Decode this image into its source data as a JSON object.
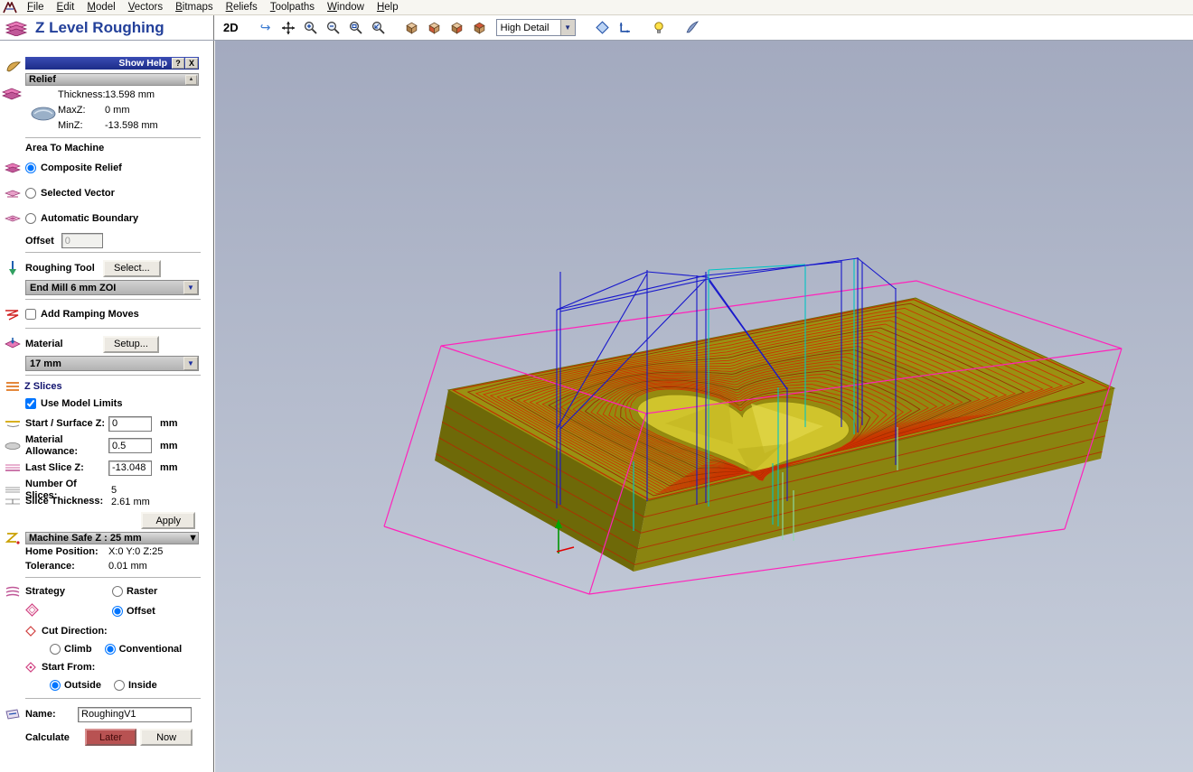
{
  "menubar": {
    "items": [
      "File",
      "Edit",
      "Model",
      "Vectors",
      "Bitmaps",
      "Reliefs",
      "Toolpaths",
      "Window",
      "Help"
    ]
  },
  "header": {
    "title": "Z Level Roughing",
    "mode_2d": "2D",
    "detail_dropdown": "High Detail"
  },
  "panel": {
    "show_help_label": "Show Help",
    "help_button": "?",
    "close_button": "X",
    "scroll_up_button": "▲",
    "relief_title": "Relief",
    "thickness_label": "Thickness:",
    "thickness_value": "13.598 mm",
    "maxz_label": "MaxZ:",
    "maxz_value": "0 mm",
    "minz_label": "MinZ:",
    "minz_value": "-13.598 mm",
    "area_title": "Area To Machine",
    "area_composite": "Composite Relief",
    "area_selected": "Selected Vector",
    "area_automatic": "Automatic Boundary",
    "offset_label": "Offset",
    "offset_value": "0",
    "roughing_tool_label": "Roughing Tool",
    "select_button": "Select...",
    "tool_value": "End Mill 6 mm ZOI",
    "ramping_label": "Add Ramping Moves",
    "material_label": "Material",
    "setup_button": "Setup...",
    "material_value": "17 mm",
    "zslices_title": "Z Slices",
    "use_model_limits": "Use Model Limits",
    "startz_label": "Start / Surface Z:",
    "startz_value": "0",
    "startz_unit": "mm",
    "allowance_label": "Material Allowance:",
    "allowance_value": "0.5",
    "allowance_unit": "mm",
    "lastz_label": "Last Slice Z:",
    "lastz_value": "-13.048",
    "lastz_unit": "mm",
    "num_slices_label": "Number Of Slices:",
    "num_slices_value": "5",
    "slice_thickness_label": "Slice Thickness:",
    "slice_thickness_value": "2.61 mm",
    "apply_button": "Apply",
    "safez_label": "Machine Safe Z : 25 mm",
    "home_label": "Home Position:",
    "home_value": "X:0 Y:0 Z:25",
    "tolerance_label": "Tolerance:",
    "tolerance_value": "0.01 mm",
    "strategy_label": "Strategy",
    "raster_label": "Raster",
    "offset_strategy_label": "Offset",
    "cut_direction_label": "Cut Direction:",
    "climb_label": "Climb",
    "conventional_label": "Conventional",
    "start_from_label": "Start From:",
    "outside_label": "Outside",
    "inside_label": "Inside",
    "name_label": "Name:",
    "name_value": "RoughingV1",
    "calculate_label": "Calculate",
    "later_button": "Later",
    "now_button": "Now"
  },
  "colors": {
    "accent_blue": "#23409a",
    "toolpath_red": "#cc3300",
    "material_yellow": "#9a9112",
    "wireframe_magenta": "#ff22bb",
    "rapid_blue": "#1818cc",
    "plunge_cyan": "#00c4c4",
    "later_red": "#b85252"
  }
}
